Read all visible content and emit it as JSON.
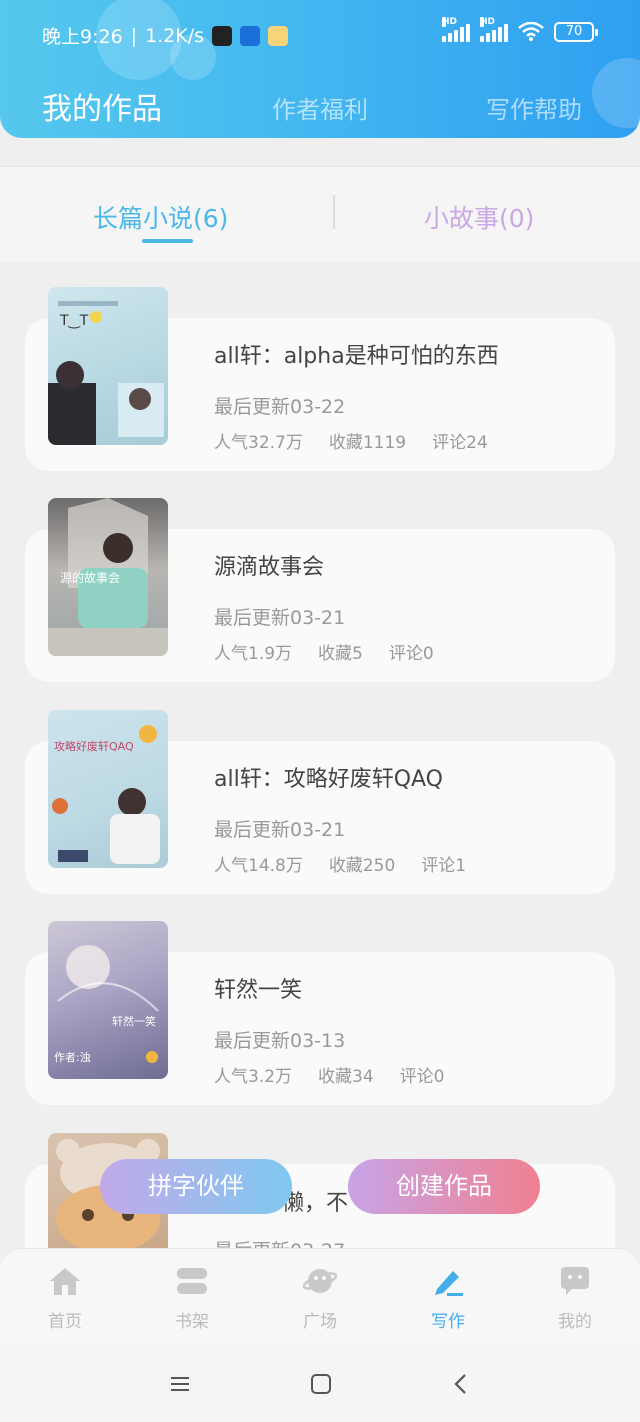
{
  "status_bar": {
    "time": "晚上9:26",
    "speed": "1.2K/s",
    "battery": "70",
    "hd": "HD"
  },
  "header": {
    "tabs": [
      "我的作品",
      "作者福利",
      "写作帮助"
    ]
  },
  "subtabs": {
    "long": "长篇小说(6)",
    "short": "小故事(0)"
  },
  "works": [
    {
      "title": "all轩：alpha是种可怕的东西",
      "updated": "最后更新03-22",
      "popularity": "人气32.7万",
      "favorites": "收藏1119",
      "comments": "评论24"
    },
    {
      "title": "源滴故事会",
      "updated": "最后更新03-21",
      "popularity": "人气1.9万",
      "favorites": "收藏5",
      "comments": "评论0"
    },
    {
      "title": "all轩：攻略好废轩QAQ",
      "updated": "最后更新03-21",
      "popularity": "人气14.8万",
      "favorites": "收藏250",
      "comments": "评论1"
    },
    {
      "title": "轩然一笑",
      "updated": "最后更新03-13",
      "popularity": "人气3.2万",
      "favorites": "收藏34",
      "comments": "评论0"
    },
    {
      "title_visible": "懒，不",
      "updated_visible": "最后更新03-27"
    }
  ],
  "buttons": {
    "partner": "拼字伙伴",
    "create": "创建作品"
  },
  "bottom_nav": [
    {
      "label": "首页",
      "icon": "home-icon"
    },
    {
      "label": "书架",
      "icon": "bookshelf-icon"
    },
    {
      "label": "广场",
      "icon": "planet-icon"
    },
    {
      "label": "写作",
      "icon": "pen-icon"
    },
    {
      "label": "我的",
      "icon": "chat-bubble-icon"
    }
  ],
  "colors": {
    "accent": "#45aee8",
    "header_start": "#56c8ee",
    "header_end": "#2f9ff0",
    "short_tab": "#c9a8e6"
  }
}
